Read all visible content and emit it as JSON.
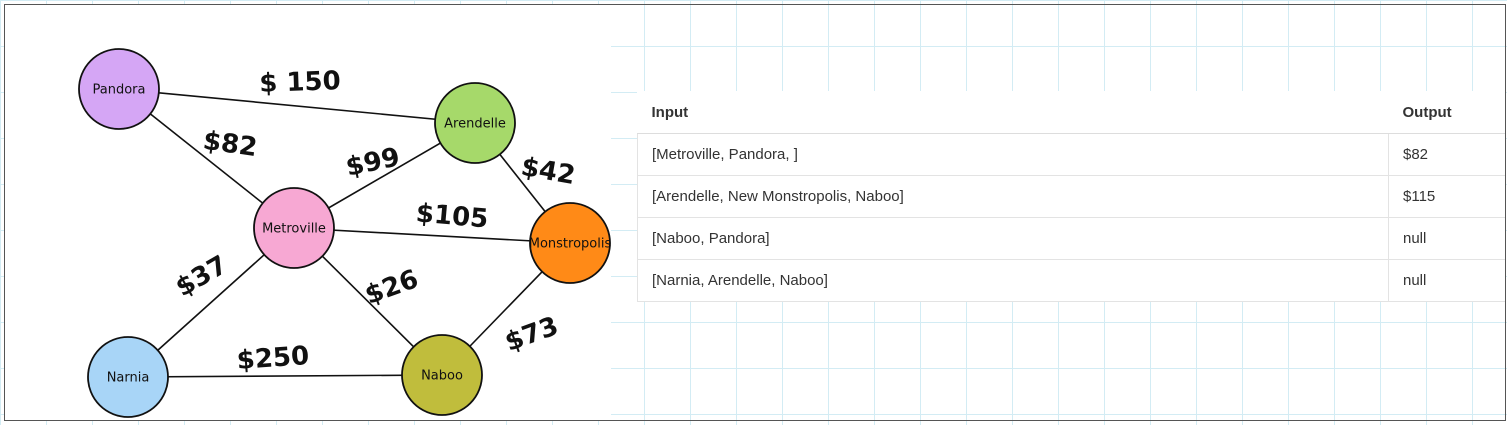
{
  "graph": {
    "nodes": [
      {
        "id": "pandora",
        "label": "Pandora",
        "color": "#d5a6f5"
      },
      {
        "id": "arendelle",
        "label": "Arendelle",
        "color": "#a6d96a"
      },
      {
        "id": "metroville",
        "label": "Metroville",
        "color": "#f7a8d3"
      },
      {
        "id": "monstropolis",
        "label": "Monstropolis",
        "color": "#ff8a17"
      },
      {
        "id": "narnia",
        "label": "Narnia",
        "color": "#a8d5f7"
      },
      {
        "id": "naboo",
        "label": "Naboo",
        "color": "#c0bd3c"
      }
    ],
    "edges": [
      {
        "from": "pandora",
        "to": "arendelle",
        "label": "$ 150"
      },
      {
        "from": "pandora",
        "to": "metroville",
        "label": "$82"
      },
      {
        "from": "metroville",
        "to": "arendelle",
        "label": "$99"
      },
      {
        "from": "arendelle",
        "to": "monstropolis",
        "label": "$42"
      },
      {
        "from": "metroville",
        "to": "monstropolis",
        "label": "$105"
      },
      {
        "from": "metroville",
        "to": "narnia",
        "label": "$37"
      },
      {
        "from": "metroville",
        "to": "naboo",
        "label": "$26"
      },
      {
        "from": "monstropolis",
        "to": "naboo",
        "label": "$73"
      },
      {
        "from": "narnia",
        "to": "naboo",
        "label": "$250"
      }
    ]
  },
  "table": {
    "headers": {
      "input": "Input",
      "output": "Output"
    },
    "rows": [
      {
        "input": "[Metroville, Pandora, ]",
        "output": "$82"
      },
      {
        "input": "[Arendelle, New Monstropolis, Naboo]",
        "output": "$115"
      },
      {
        "input": "[Naboo, Pandora]",
        "output": "null"
      },
      {
        "input": "[Narnia, Arendelle, Naboo]",
        "output": "null"
      }
    ]
  }
}
